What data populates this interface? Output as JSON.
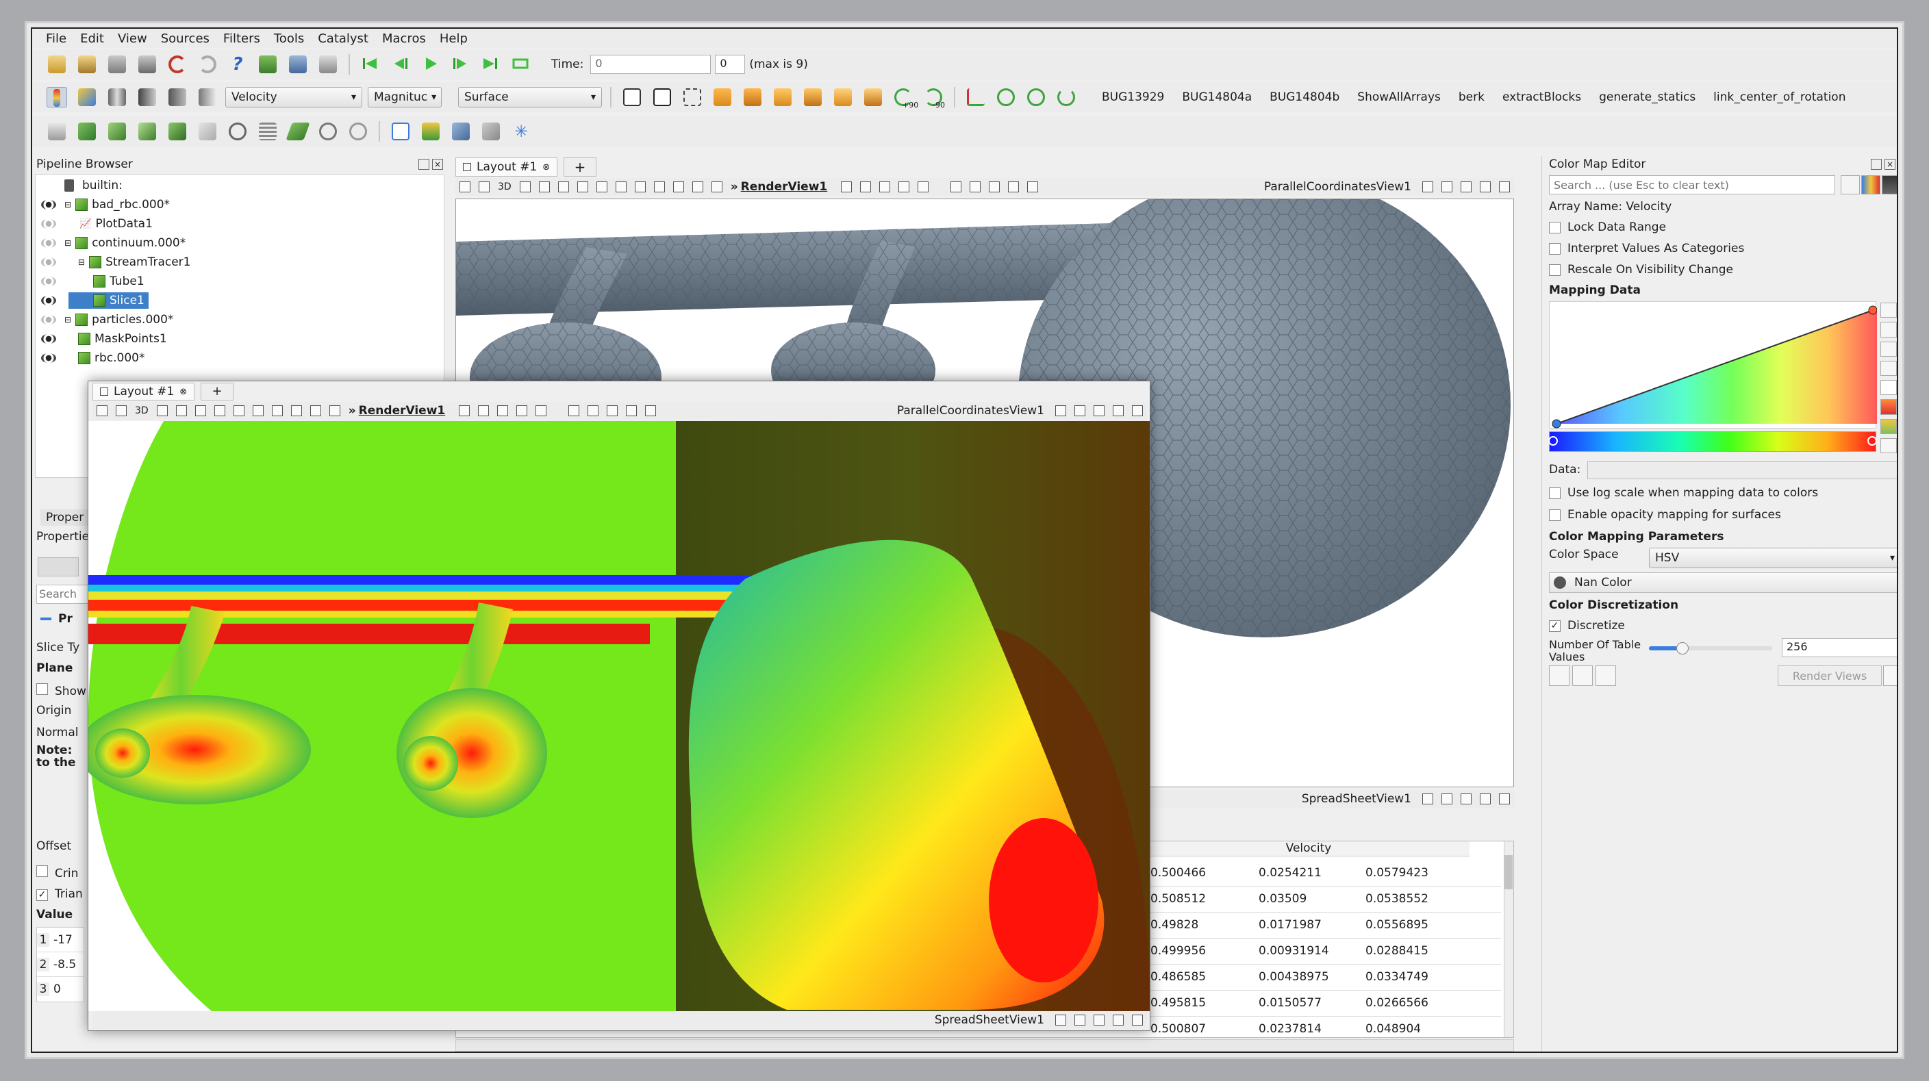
{
  "menu": [
    "File",
    "Edit",
    "View",
    "Sources",
    "Filters",
    "Tools",
    "Catalyst",
    "Macros",
    "Help"
  ],
  "time": {
    "label": "Time:",
    "value": "0",
    "step": "0",
    "max_text": "(max is 9)"
  },
  "toolbar2": {
    "array": "Velocity",
    "component": "Magnituc",
    "representation": "Surface"
  },
  "macros": [
    "BUG13929",
    "BUG14804a",
    "BUG14804b",
    "ShowAllArrays",
    "berk",
    "extractBlocks",
    "generate_statics",
    "link_center_of_rotation"
  ],
  "rotate_labels": [
    "+90",
    "-90"
  ],
  "pipeline": {
    "title": "Pipeline Browser",
    "items": [
      {
        "label": "builtin:",
        "level": 0
      },
      {
        "label": "bad_rbc.000*",
        "level": 1
      },
      {
        "label": "PlotData1",
        "level": 1
      },
      {
        "label": "continuum.000*",
        "level": 1
      },
      {
        "label": "StreamTracer1",
        "level": 2
      },
      {
        "label": "Tube1",
        "level": 3
      },
      {
        "label": "Slice1",
        "level": 3,
        "selected": true
      },
      {
        "label": "particles.000*",
        "level": 1
      },
      {
        "label": "MaskPoints1",
        "level": 1
      },
      {
        "label": "rbc.000*",
        "level": 1
      }
    ]
  },
  "properties": {
    "tab1": "Proper",
    "tab2": "Propertie",
    "search": "Search",
    "section": "Pr",
    "labels": [
      "Slice Ty",
      "Plane",
      "Show",
      "Origin",
      "Normal",
      "Note:",
      "to the",
      "Offset",
      "Crin",
      "Trian",
      "Value"
    ],
    "values": [
      {
        "idx": "1",
        "val": "-17"
      },
      {
        "idx": "2",
        "val": "-8.5"
      },
      {
        "idx": "3",
        "val": "0"
      }
    ]
  },
  "main_view": {
    "tab": "Layout #1",
    "render": "RenderView1",
    "parallel": "ParallelCoordinatesView1",
    "spreadsheet": "SpreadSheetView1",
    "three_d": "3D",
    "arrows": "»"
  },
  "overlay_view": {
    "tab": "Layout #1",
    "render": "RenderView1",
    "parallel": "ParallelCoordinatesView1",
    "spreadsheet": "SpreadSheetView1",
    "three_d": "3D",
    "plus": "+",
    "arrows": "»"
  },
  "spreadsheet": {
    "header": "Velocity",
    "rows": [
      [
        "0.500466",
        "0.0254211",
        "0.0579423"
      ],
      [
        "0.508512",
        "0.03509",
        "0.0538552"
      ],
      [
        "0.49828",
        "0.0171987",
        "0.0556895"
      ],
      [
        "0.499956",
        "0.00931914",
        "0.0288415"
      ],
      [
        "0.486585",
        "0.00438975",
        "0.0334749"
      ],
      [
        "0.495815",
        "0.0150577",
        "0.0266566"
      ],
      [
        "0.500807",
        "0.0237814",
        "0.048904"
      ]
    ]
  },
  "colormap": {
    "title": "Color Map Editor",
    "search_placeholder": "Search ... (use Esc to clear text)",
    "array_name": "Array Name: Velocity",
    "lock": "Lock Data Range",
    "interpret": "Interpret Values As Categories",
    "rescale": "Rescale On Visibility Change",
    "mapping_data": "Mapping Data",
    "data_label": "Data:",
    "log_scale": "Use log scale when mapping data to colors",
    "opacity": "Enable opacity mapping for surfaces",
    "params": "Color Mapping Parameters",
    "color_space_label": "Color Space",
    "color_space": "HSV",
    "nan_color": "Nan Color",
    "discretization": "Color Discretization",
    "discretize": "Discretize",
    "table_values_label1": "Number Of Table",
    "table_values_label2": "Values",
    "table_values": "256",
    "table_slider_fraction": 0.27,
    "render_views": "Render Views"
  }
}
